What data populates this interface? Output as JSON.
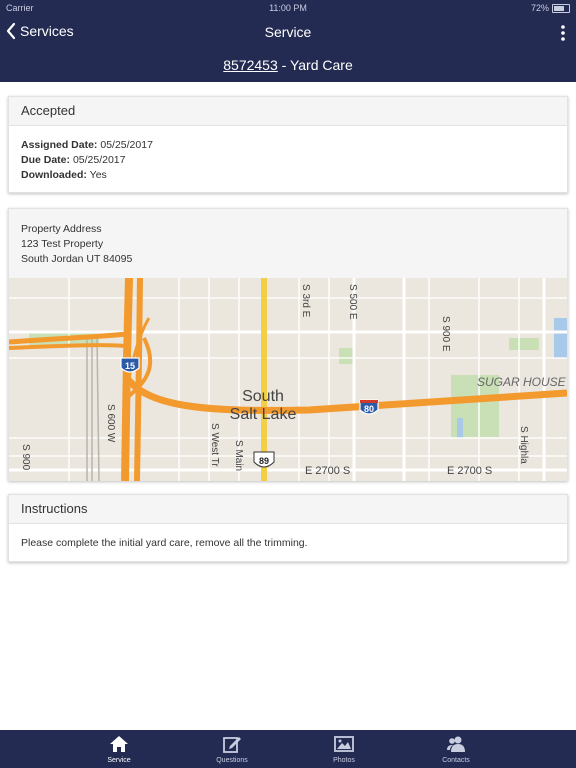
{
  "status_bar": {
    "carrier": "Carrier",
    "time": "11:00 PM",
    "battery": "72%"
  },
  "nav": {
    "back_label": "Services",
    "title": "Service"
  },
  "sub_header": {
    "order_number": "8572453",
    "separator": " - ",
    "service_type": "Yard Care"
  },
  "status_card": {
    "title": "Accepted",
    "rows": [
      {
        "label": "Assigned Date:",
        "value": "05/25/2017"
      },
      {
        "label": "Due Date:",
        "value": "05/25/2017"
      },
      {
        "label": "Downloaded:",
        "value": "Yes"
      }
    ]
  },
  "address_card": {
    "label": "Property Address",
    "line1": "123 Test Property",
    "line2": "South Jordan UT 84095"
  },
  "map": {
    "city_line1": "South",
    "city_line2": "Salt Lake",
    "neighborhood": "SUGAR HOUSE",
    "shield_i15": "15",
    "shield_i80": "80",
    "shield_us89": "89",
    "street_3rd_e": "S 3rd E",
    "street_500_e": "S 500 E",
    "street_900_e": "S 900 E",
    "street_600_w": "S 600 W",
    "street_900_w": "S 900",
    "street_west_t": "S West Tr",
    "street_main": "S Main",
    "street_2700_a": "E 2700 S",
    "street_2700_b": "E 2700 S",
    "street_highland": "S Highla"
  },
  "instructions_card": {
    "title": "Instructions",
    "text": "Please complete the initial yard care, remove all the trimming."
  },
  "tabs": [
    {
      "label": "Service",
      "icon": "home-icon"
    },
    {
      "label": "Questions",
      "icon": "edit-icon"
    },
    {
      "label": "Photos",
      "icon": "photos-icon"
    },
    {
      "label": "Contacts",
      "icon": "contacts-icon"
    }
  ],
  "colors": {
    "navy": "#232b52",
    "highway": "#f29a2e",
    "map_bg": "#ebe6de",
    "active_tab": "#ffffff",
    "inactive_tab": "#c9cde0"
  }
}
